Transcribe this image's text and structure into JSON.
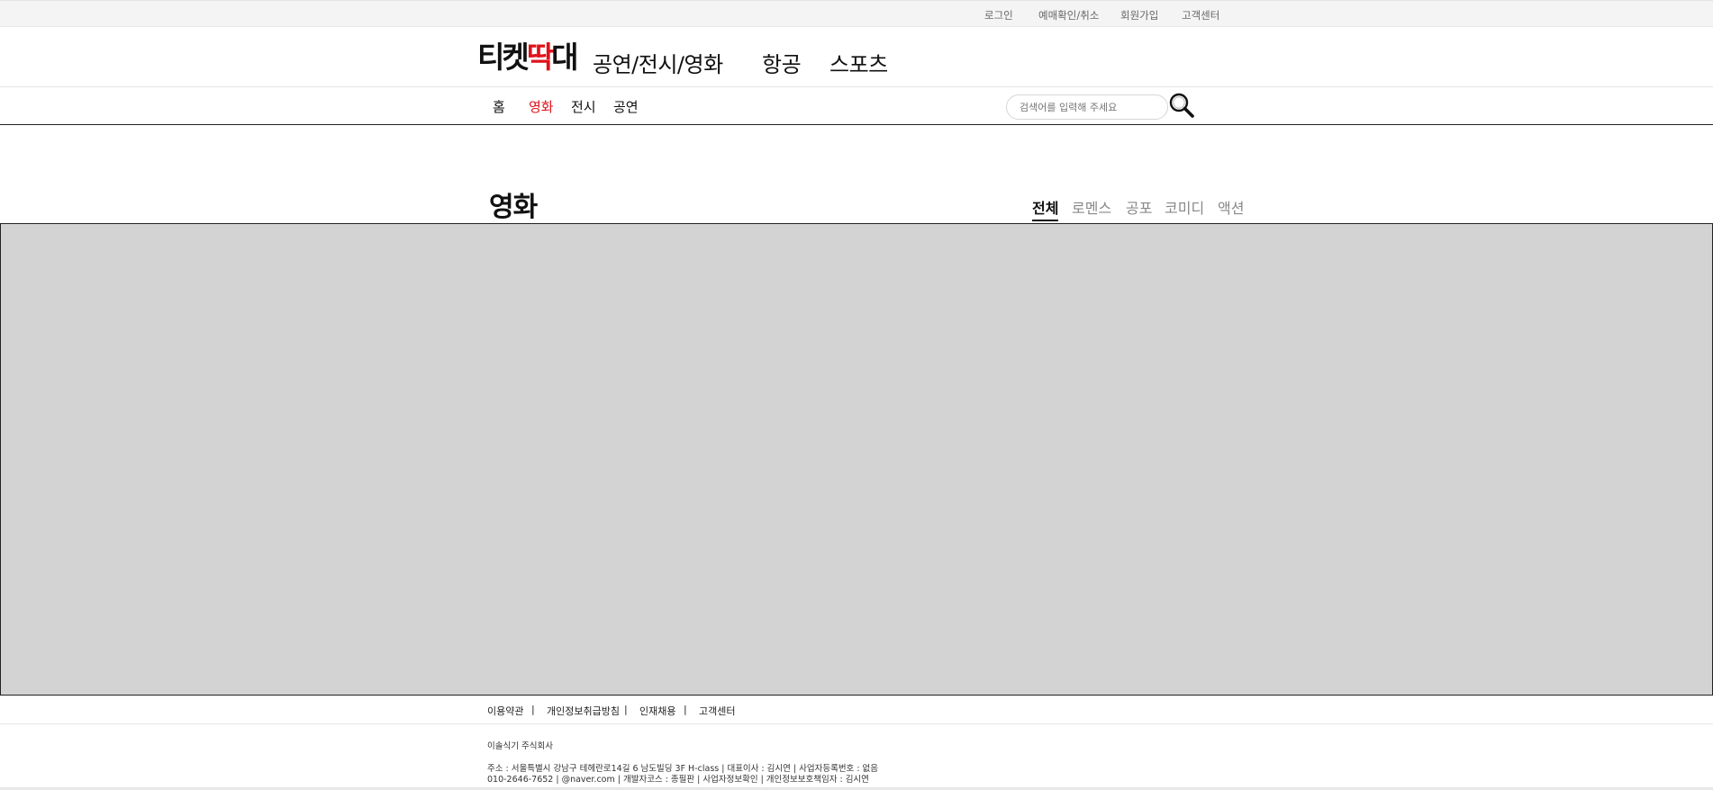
{
  "topbar": {
    "login": "로그인",
    "reservation": "예매확인/취소",
    "signup": "회원가입",
    "support": "고객센터"
  },
  "header": {
    "logo": {
      "part1": "티켓",
      "part2": "딱",
      "part3": "대"
    },
    "nav": [
      "공연/전시/영화",
      "항공",
      "스포츠"
    ]
  },
  "subnav": {
    "items": [
      "홈",
      "영화",
      "전시",
      "공연"
    ],
    "active": "영화",
    "search_placeholder": "검색어를 입력해 주세요"
  },
  "page": {
    "title": "영화",
    "tabs": [
      "전체",
      "로멘스",
      "공포",
      "코미디",
      "액션"
    ],
    "active_tab": "전체"
  },
  "footer": {
    "links": [
      "이용약관",
      "개인정보취급방침",
      "인재채용",
      "고객센터"
    ],
    "separator": "|",
    "company": "이솔식기 주식회사",
    "address": "주소 : 서울특별시 강남구 테헤란로14길 6 남도빌딩 3F H-class | 대표이사 : 김시연 | 사업자등록번호 : 없음",
    "contact": "010-2646-7652 | @naver.com | 개발자코스 : 종필판 | 사업자정보확인 | 개인정보보호책임자 : 김시연"
  },
  "colors": {
    "accent": "#e0121a",
    "content_placeholder": "#d3d3d3",
    "topbar_bg": "#f4f4f4"
  },
  "icons": {
    "search": "magnifier-icon"
  }
}
